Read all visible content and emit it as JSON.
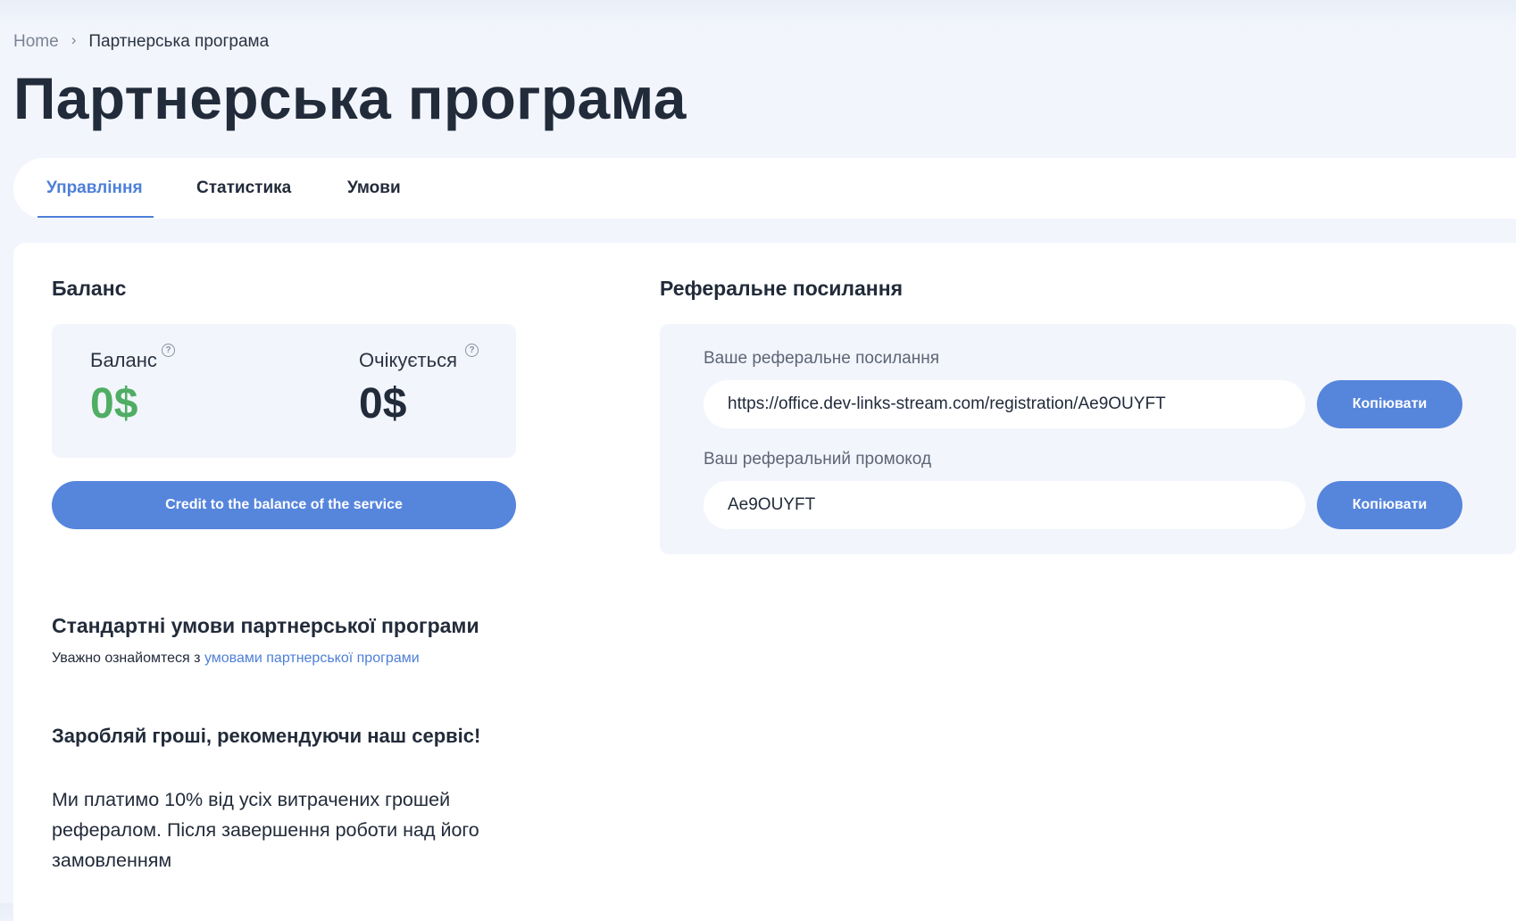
{
  "breadcrumb": {
    "home": "Home",
    "separator": "›",
    "current": "Партнерська програма"
  },
  "page": {
    "title": "Партнерська програма"
  },
  "tabs": [
    {
      "label": "Управління",
      "active": true
    },
    {
      "label": "Статистика",
      "active": false
    },
    {
      "label": "Умови",
      "active": false
    }
  ],
  "balance": {
    "section_title": "Баланс",
    "balance_label": "Баланс",
    "balance_value": "0$",
    "pending_label": "Очікується",
    "pending_value": "0$",
    "help_icon": "question-circle-icon",
    "credit_button": "Credit to the balance of the service"
  },
  "referral": {
    "section_title": "Реферальне посилання",
    "link_label": "Ваше реферальне посилання",
    "link_value": "https://office.dev-links-stream.com/registration/Ae9OUYFT",
    "promo_label": "Ваш реферальний промокод",
    "promo_value": "Ae9OUYFT",
    "copy_button": "Копіювати"
  },
  "terms": {
    "title": "Стандартні умови партнерської програми",
    "intro_prefix": "Уважно ознайомтеся з ",
    "intro_link": "умовами партнерської програми",
    "headline": "Заробляй гроші, рекомендуючи наш сервіс!",
    "paragraph": "Ми платимо 10% від усіх витрачених грошей рефералом. Після завершення роботи над його замовленням"
  },
  "colors": {
    "accent": "#5685dc",
    "tab_active": "#4d7fd8",
    "balance_green": "#4fad64",
    "text_dark": "#222b3a",
    "background": "#f2f5fc"
  }
}
